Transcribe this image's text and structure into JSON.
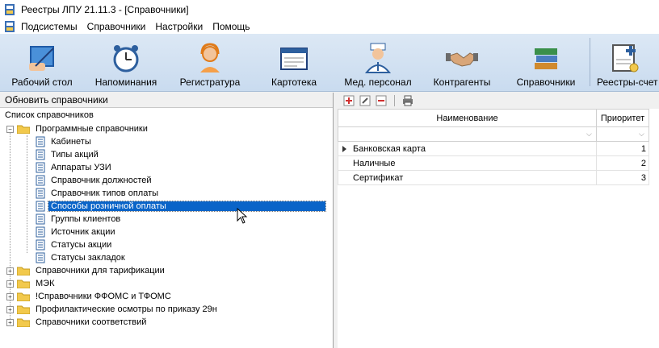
{
  "window": {
    "title": "Реестры ЛПУ 21.11.3 - [Справочники]"
  },
  "menu": [
    "Подсистемы",
    "Справочники",
    "Настройки",
    "Помощь"
  ],
  "toolbar": [
    {
      "label": "Рабочий стол",
      "icon": "desktop-icon"
    },
    {
      "label": "Напоминания",
      "icon": "alarm-clock-icon"
    },
    {
      "label": "Регистратура",
      "icon": "receptionist-icon"
    },
    {
      "label": "Картотека",
      "icon": "card-index-icon"
    },
    {
      "label": "Мед. персонал",
      "icon": "doctor-icon"
    },
    {
      "label": "Контрагенты",
      "icon": "handshake-icon"
    },
    {
      "label": "Справочники",
      "icon": "books-icon"
    },
    {
      "label": "Реестры-счет",
      "icon": "invoice-icon"
    }
  ],
  "left": {
    "header": "Обновить справочники",
    "tree_title": "Список справочников",
    "root_open": "Программные справочники",
    "children": [
      "Кабинеты",
      "Типы акций",
      "Аппараты УЗИ",
      "Справочник должностей",
      "Справочник типов оплаты",
      "Способы розничной оплаты",
      "Группы клиентов",
      "Источник акции",
      "Статусы акции",
      "Статусы закладок"
    ],
    "selected_index": 5,
    "collapsed": [
      "Справочники для тарификации",
      "МЭК",
      "!Справочники ФФОМС и ТФОМС",
      "Профилактические осмотры по приказу 29н",
      "Справочники соответствий"
    ]
  },
  "right": {
    "columns": [
      "Наименование",
      "Приоритет"
    ],
    "rows": [
      {
        "name": "Банковская карта",
        "priority": "1"
      },
      {
        "name": "Наличные",
        "priority": "2"
      },
      {
        "name": "Сертификат",
        "priority": "3"
      }
    ]
  },
  "colors": {
    "selection": "#0a64c8",
    "toolbar": "#d4e3f3"
  }
}
